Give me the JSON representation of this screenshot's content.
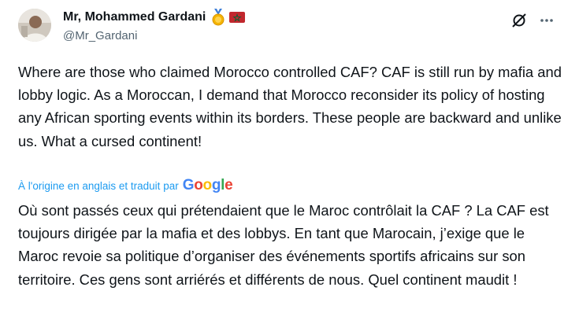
{
  "author": {
    "display_name": "Mr, Mohammed Gardani",
    "handle": "@Mr_Gardani",
    "badges": [
      "medal-icon",
      "morocco-flag-icon"
    ]
  },
  "post": {
    "original_text": "Where are those who claimed Morocco controlled CAF? CAF is still run by mafia and lobby logic. As a Moroccan, I demand that Morocco reconsider its policy of hosting any African sporting events within its borders. These people are backward and unlike us. What a cursed continent!",
    "translation_note": "À l'origine en anglais et traduit par",
    "translator": "Google",
    "translated_text": "Où sont passés ceux qui prétendaient que le Maroc contrôlait la CAF ? La CAF est toujours dirigée par la mafia et des lobbys. En tant que Marocain, j’exige que le Maroc revoie sa politique d’organiser des événements sportifs africains sur son territoire. Ces gens sont arriérés et différents de nous. Quel continent maudit !"
  },
  "colors": {
    "text": "#0f1419",
    "secondary": "#536471",
    "link": "#1d9bf0",
    "flag_red": "#c1272d",
    "flag_green": "#006233",
    "medal_gold": "#f4b400"
  }
}
